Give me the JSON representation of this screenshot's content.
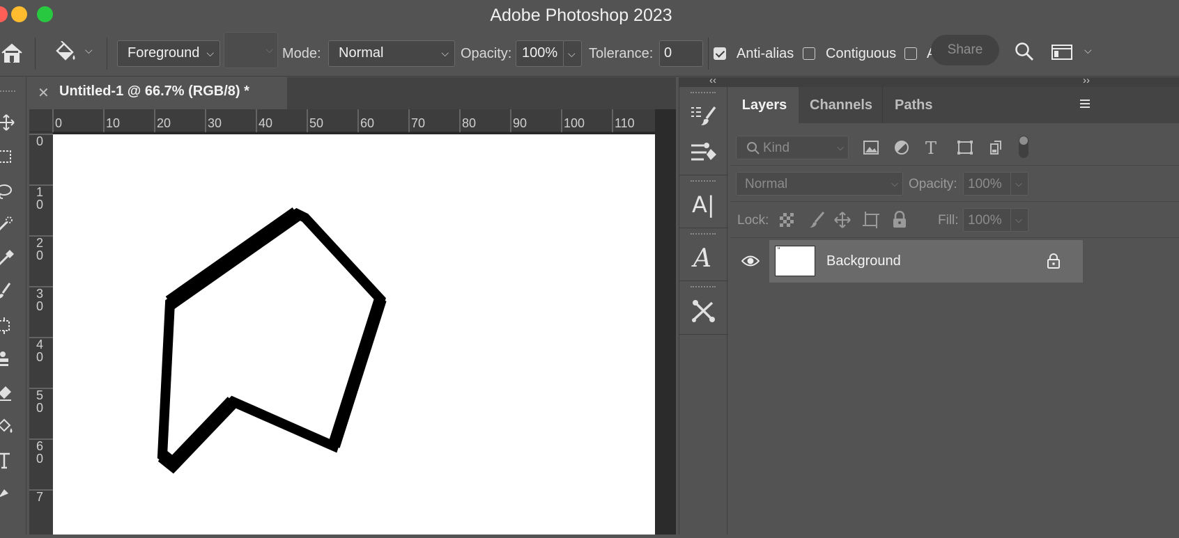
{
  "window": {
    "title": "Adobe Photoshop 2023",
    "controls": [
      "close",
      "minimize",
      "maximize"
    ],
    "colors": {
      "close": "#ff5f57",
      "minimize": "#febc2e",
      "maximize": "#28c840"
    }
  },
  "options_bar": {
    "home_icon": "home-icon",
    "tool_icon": "paint-bucket-icon",
    "source": "Foreground",
    "pattern": "",
    "mode_label": "Mode:",
    "mode_value": "Normal",
    "opacity_label": "Opacity:",
    "opacity_value": "100%",
    "tolerance_label": "Tolerance:",
    "tolerance_value": "0",
    "antialias_label": "Anti-alias",
    "antialias_checked": true,
    "contiguous_label": "Contiguous",
    "contiguous_checked": false,
    "all_layers_label": "A",
    "share_label": "Share"
  },
  "document": {
    "tab_title": "Untitled-1 @ 66.7% (RGB/8) *",
    "ruler_top": [
      "0",
      "10",
      "20",
      "30",
      "40",
      "50",
      "60",
      "70",
      "80",
      "90",
      "100",
      "110"
    ],
    "ruler_left": [
      "0",
      "1\n0",
      "2\n0",
      "3\n0",
      "4\n0",
      "5\n0",
      "6\n0",
      "7"
    ]
  },
  "layers_panel": {
    "tabs": [
      "Layers",
      "Channels",
      "Paths"
    ],
    "active_tab": "Layers",
    "filter_placeholder": "Kind",
    "blend_mode": "Normal",
    "opacity_label": "Opacity:",
    "opacity_value": "100%",
    "lock_label": "Lock:",
    "fill_label": "Fill:",
    "fill_value": "100%",
    "layers": [
      {
        "name": "Background",
        "visible": true,
        "locked": true
      }
    ]
  }
}
